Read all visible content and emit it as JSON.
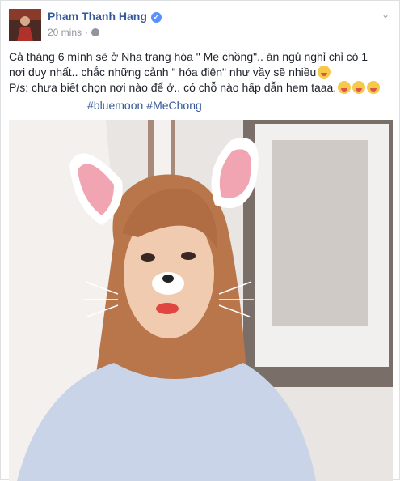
{
  "post": {
    "author": "Pham Thanh Hang",
    "timestamp": "20 mins",
    "dot": "·",
    "lines": [
      "Cả tháng 6 mình sẽ ở Nha trang hóa \" Mẹ chồng\".. ăn ngủ nghỉ chỉ có 1",
      "nơi duy nhất.. chắc những cảnh \" hóa điên\" như vầy sẽ nhiều",
      "P/s: chưa biết chọn nơi nào để ở.. có chỗ nào hấp dẫn hem taaa."
    ],
    "hashtags": [
      "#bluemoon",
      "#MeChong"
    ]
  },
  "icons": {
    "verified": "verified-badge-icon",
    "audience": "globe-icon",
    "menu": "chevron-down-icon",
    "emoji": "tongue-out-emoji-icon"
  },
  "colors": {
    "link": "#365899",
    "meta": "#90949c",
    "text": "#1d2129",
    "verified": "#5890ff"
  }
}
